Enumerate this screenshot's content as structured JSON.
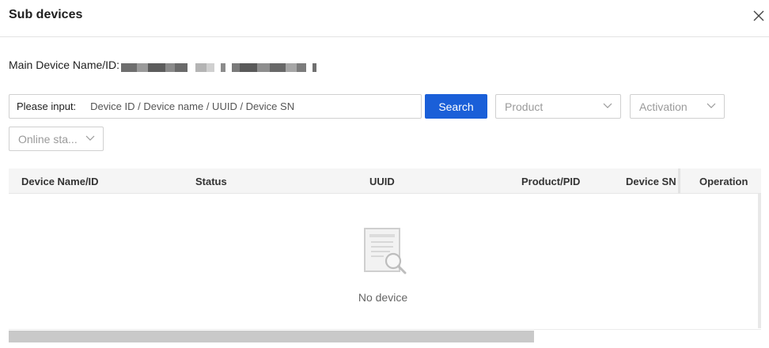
{
  "dialog": {
    "title": "Sub devices",
    "close_icon": "close-icon"
  },
  "main_device": {
    "label": "Main Device Name/ID:",
    "value_redacted": true
  },
  "filters": {
    "search_label": "Please input:",
    "search_placeholder": "Device ID / Device name / UUID / Device SN",
    "search_button": "Search",
    "product_placeholder": "Product",
    "activation_placeholder": "Activation",
    "online_status_placeholder": "Online sta...",
    "chevron_icon": "chevron-down-icon"
  },
  "table": {
    "columns": [
      "Device Name/ID",
      "Status",
      "UUID",
      "Product/PID",
      "Device SN",
      "Operation"
    ],
    "rows": [],
    "empty_text": "No device",
    "empty_icon": "empty-document-search-icon"
  },
  "colors": {
    "primary": "#1a5fd8",
    "header_bg": "#f5f5f5",
    "border": "#d0d0d0",
    "scrollbar": "#c9c9c9"
  }
}
